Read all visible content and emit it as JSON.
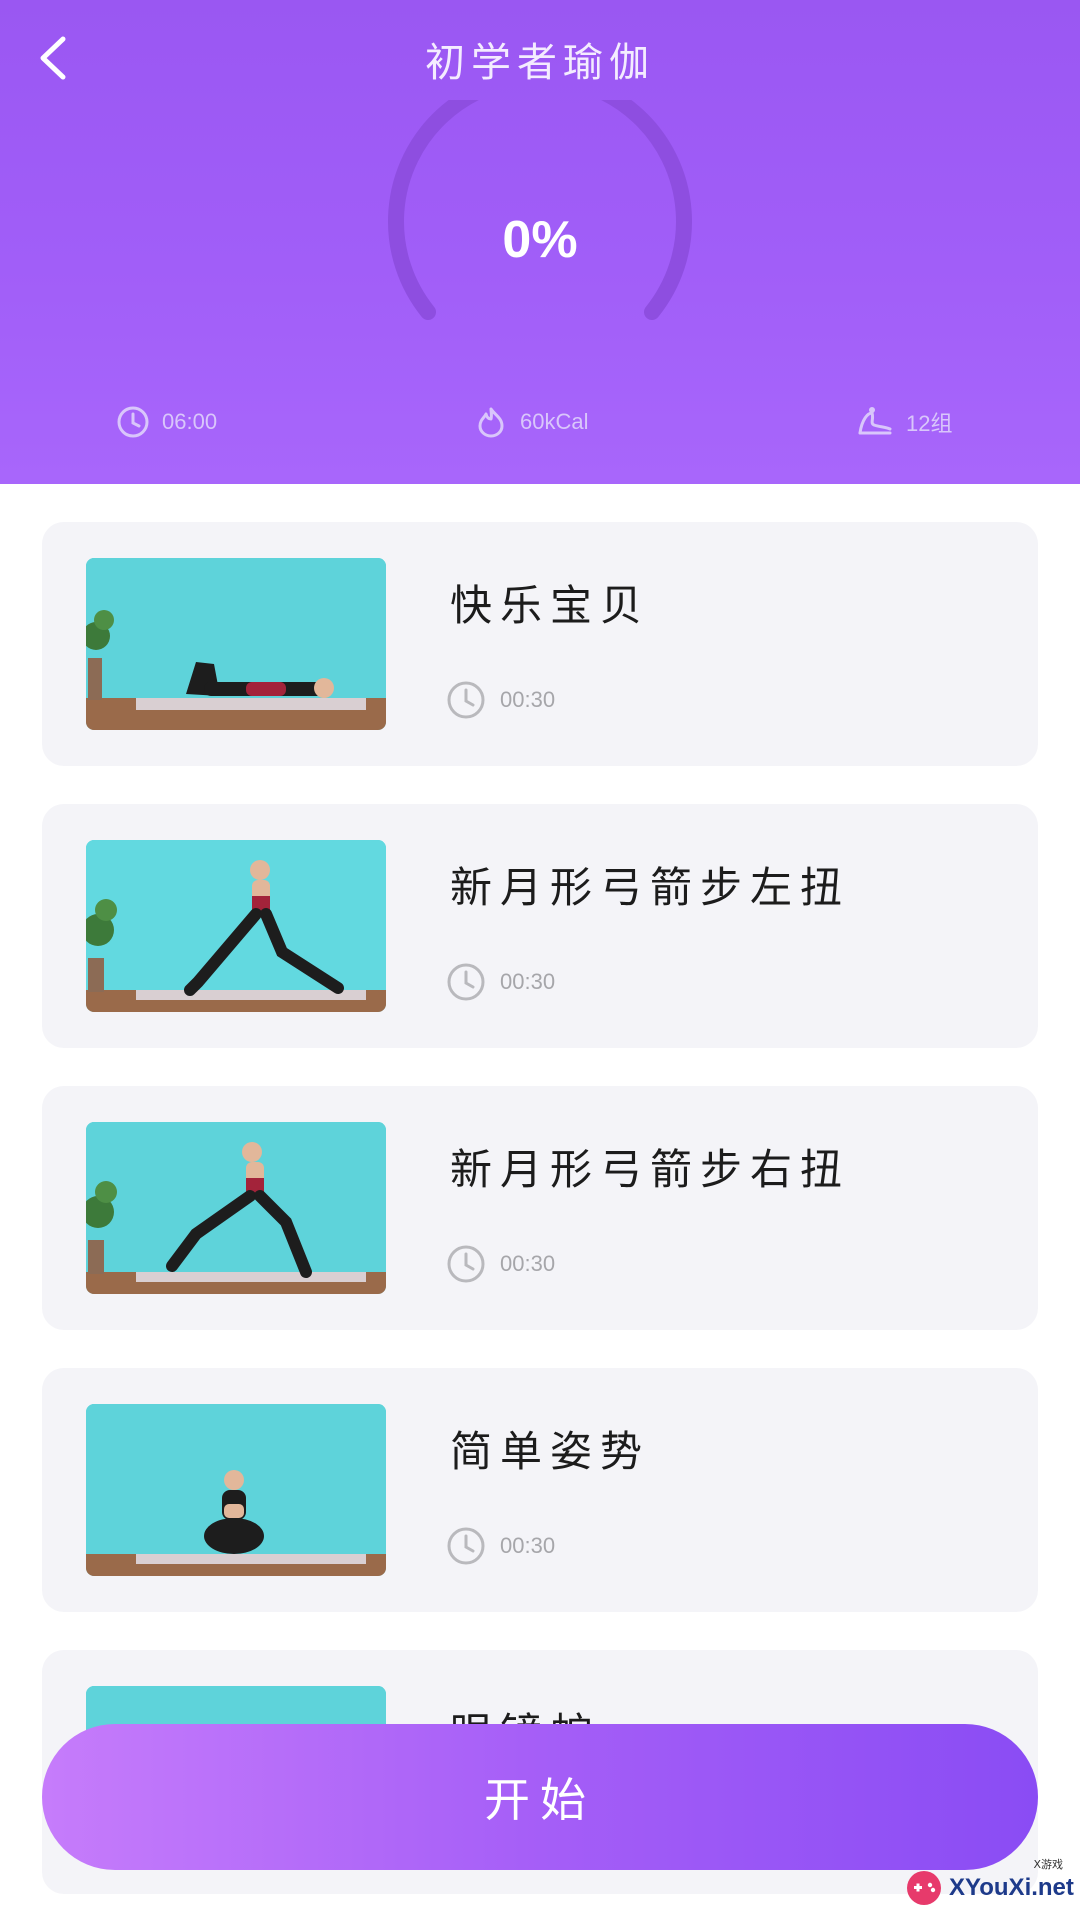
{
  "header": {
    "title": "初学者瑜伽",
    "progress_text": "0%",
    "progress_fraction": 0.0,
    "stats": {
      "duration": "06:00",
      "calories": "60kCal",
      "groups": "12组"
    },
    "colors": {
      "top": "#9a57f2",
      "bottom": "#a866fb"
    }
  },
  "exercises": [
    {
      "name": "快乐宝贝",
      "duration": "00:30",
      "pose": "lying"
    },
    {
      "name": "新月形弓箭步左扭",
      "duration": "00:30",
      "pose": "lunge-left"
    },
    {
      "name": "新月形弓箭步右扭",
      "duration": "00:30",
      "pose": "lunge-right"
    },
    {
      "name": "简单姿势",
      "duration": "00:30",
      "pose": "seated"
    },
    {
      "name": "眼镜蛇",
      "duration": "",
      "pose": "partial"
    }
  ],
  "start_button": {
    "label": "开始"
  },
  "watermark": {
    "text": "XYouXi.net",
    "small": "X游戏"
  },
  "icons": {
    "back": "chevron-left-icon",
    "clock": "clock-icon",
    "calories": "flame-icon",
    "groups": "stretch-icon"
  }
}
